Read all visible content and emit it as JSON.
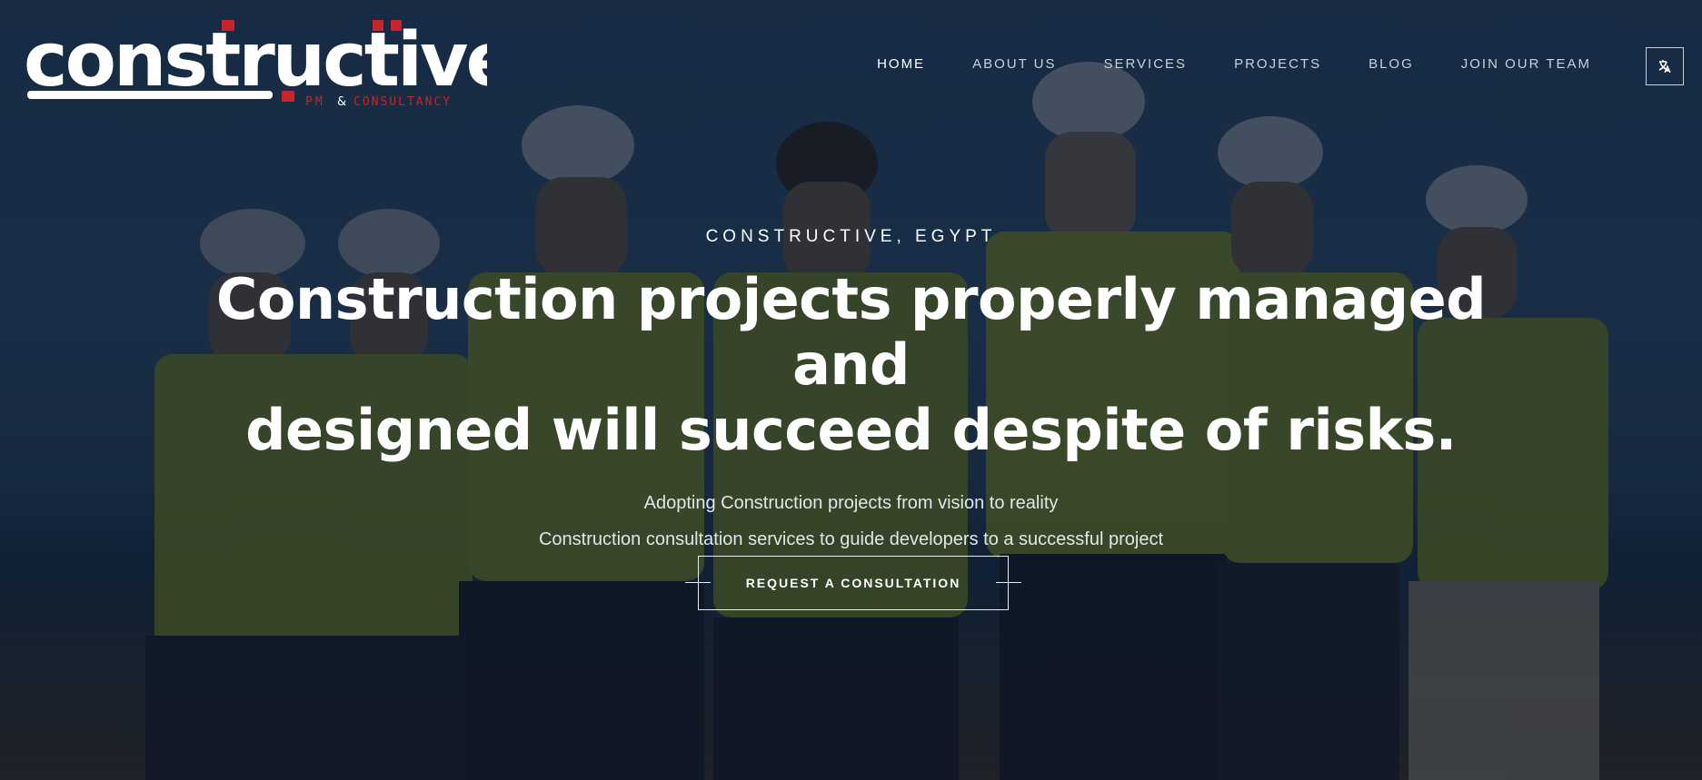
{
  "brand": {
    "name": "constructive",
    "tagline_left": "PM",
    "tagline_amp": "&",
    "tagline_right": "CONSULTANCY",
    "accent_color": "#c8242b"
  },
  "nav": {
    "items": [
      {
        "label": "HOME",
        "active": true
      },
      {
        "label": "ABOUT US",
        "active": false
      },
      {
        "label": "SERVICES",
        "active": false
      },
      {
        "label": "PROJECTS",
        "active": false
      },
      {
        "label": "BLOG",
        "active": false
      },
      {
        "label": "JOIN OUR TEAM",
        "active": false
      }
    ],
    "lang_icon": "language-switch-icon"
  },
  "hero": {
    "eyebrow": "CONSTRUCTIVE, EGYPT",
    "headline_line1": "Construction projects properly managed and",
    "headline_line2": "designed will succeed despite of risks.",
    "sub_line1": "Adopting Construction projects from vision to reality",
    "sub_line2": "Construction consultation services to guide developers to a successful project",
    "cta_label": "REQUEST A CONSULTATION"
  }
}
